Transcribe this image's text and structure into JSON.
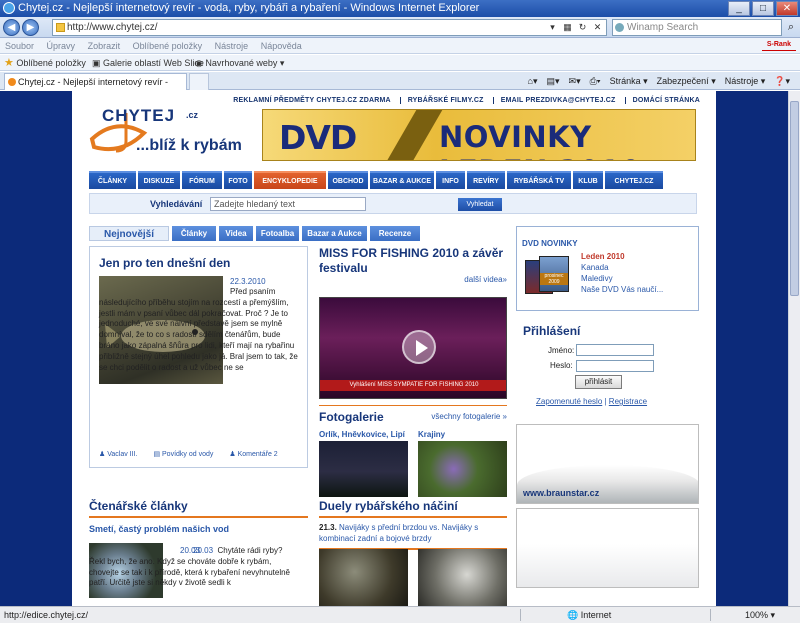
{
  "browser": {
    "title": "Chytej.cz - Nejlepší internetový revír - voda, ryby, rybáři a rybaření - Windows Internet Explorer",
    "address": "http://www.chytej.cz/",
    "search_placeholder": "Winamp Search",
    "menu": [
      "Soubor",
      "Úpravy",
      "Zobrazit",
      "Oblíbené položky",
      "Nástroje",
      "Nápověda"
    ],
    "srank": "S-Rank",
    "favorites": [
      "Oblíbené položky",
      "Galerie oblastí Web Slice",
      "Navrhované weby"
    ],
    "tab_title": "Chytej.cz - Nejlepší internetový revír - voda, ryby, ry...",
    "commands": [
      "Stránka",
      "Zabezpečení",
      "Nástroje"
    ],
    "status_url": "http://edice.chytej.cz/",
    "status_zone": "Internet",
    "zoom": "100%"
  },
  "site": {
    "top_links": [
      "REKLAMNÍ PŘEDMĚTY CHYTEJ.CZ ZDARMA",
      "RYBÁŘSKÉ FILMY.CZ",
      "EMAIL PREZDIVKA@CHYTEJ.CZ",
      "DOMÁCÍ STRÁNKA"
    ],
    "logo_name": "CHYTEJ",
    "logo_tld": ".cz",
    "slogan": "...blíž k rybám",
    "banner_left": "DVD",
    "banner_right": "NOVINKY LEDEN 2010",
    "nav": [
      "ČLÁNKY",
      "DISKUZE",
      "FÓRUM",
      "FOTO",
      "ENCYKLOPEDIE",
      "OBCHOD",
      "BAZAR & AUKCE",
      "INFO",
      "REVÍRY",
      "RYBÁŘSKÁ TV",
      "KLUB",
      "CHYTEJ.CZ"
    ],
    "search_label": "Vyhledávání",
    "search_placeholder": "Zadejte hledaný text",
    "search_button": "Vyhledat",
    "subtabs": [
      "Nejnovější",
      "Články",
      "Videa",
      "Fotoalba",
      "Bazar a Aukce",
      "Recenze"
    ],
    "article": {
      "title": "Jen pro ten dnešní den",
      "date": "22.3.2010",
      "text": "Před psaním následujícího příběhu stojím na rozcestí a přemýšlím, jestli mám v psaní vůbec dál pokračovat. Proč ? Je to jednoduché, ve své naivní představě jsem se mylně domníval, že to co s radostí sdělím čtenářům, bude bráno jako zápalná šňůra pro lidi, kteří mají na rybařinu přibližně stejný úhel pohledu jako já. Bral jsem to tak, že se chci podělit o radost a už vůbec ne se",
      "author": "Vaclav III.",
      "category": "Povídky od vody",
      "comments": "Komentáře 2"
    },
    "video": {
      "title": "MISS FOR FISHING 2010 a závěr festivalu",
      "more": "další videa»",
      "caption": "Vyhlášení MISS SYMPATIE FOR FISHING 2010"
    },
    "gallery": {
      "title": "Fotogalerie",
      "more": "všechny fotogalerie »",
      "items": [
        "Orlík, Hněvkovice, Lipí",
        "Krajiny"
      ]
    },
    "duels": {
      "title": "Duely rybářského náčiní",
      "date": "21.3.",
      "text": "Navijáky s přední brzdou vs. Navijáky s kombinací zadní a bojové brzdy"
    },
    "reader": {
      "title": "Čtenářské články",
      "subtitle": "Smetí, častý problém našich vod",
      "date": "20.03",
      "text": "Chytáte rádi ryby? Řekl bych, že ano. Když se chováte dobře k rybám, chovejte se tak i k přírodě, která k rybaření nevyhnutelně patří. Určitě jste si někdy v životě sedli k"
    },
    "dvd_box": {
      "title": "DVD NOVINKY",
      "cover_label": "prosinec 2009",
      "lines": [
        "Leden 2010",
        "Kanada",
        "Maledivy",
        "Naše DVD Vás naučí..."
      ]
    },
    "login": {
      "title": "Přihlášení",
      "name_label": "Jméno:",
      "pass_label": "Heslo:",
      "button": "přihlásit",
      "forgot": "Zapomenuté heslo",
      "register": "Registrace"
    },
    "ad1_url": "www.braunstar.cz"
  }
}
